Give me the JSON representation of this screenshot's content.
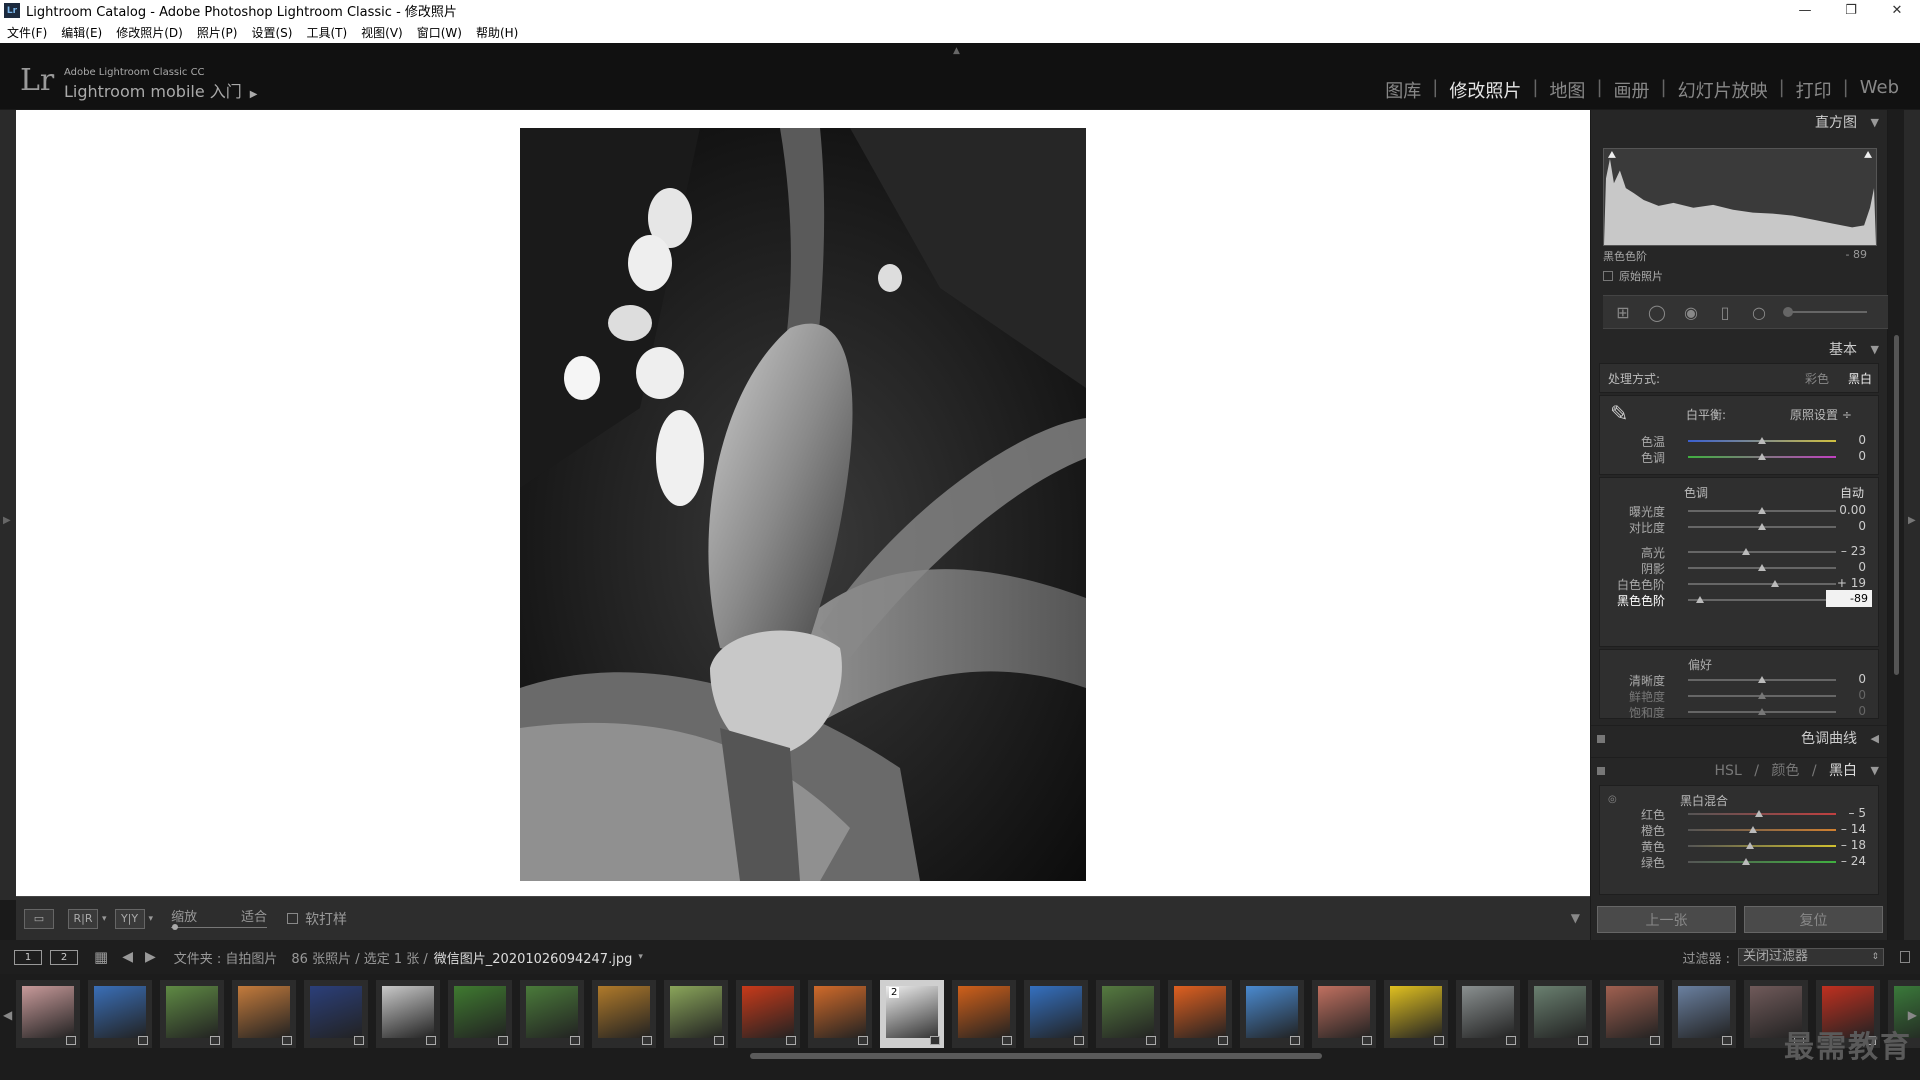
{
  "window": {
    "title": "Lightroom Catalog - Adobe Photoshop Lightroom Classic - 修改照片",
    "app_icon": "Lr"
  },
  "menu": [
    "文件(F)",
    "编辑(E)",
    "修改照片(D)",
    "照片(P)",
    "设置(S)",
    "工具(T)",
    "视图(V)",
    "窗口(W)",
    "帮助(H)"
  ],
  "identity": {
    "logo": "Lr",
    "product": "Adobe Lightroom Classic CC",
    "mobile": "Lightroom mobile 入门"
  },
  "modules": [
    "图库",
    "修改照片",
    "地图",
    "画册",
    "幻灯片放映",
    "打印",
    "Web"
  ],
  "active_module": "修改照片",
  "toolbar": {
    "zoom_label": "缩放",
    "fit_label": "适合",
    "softproof": "软打样"
  },
  "histogram": {
    "title": "直方图",
    "label": "黑色色阶",
    "value": "- 89",
    "original": "原始照片"
  },
  "basic": {
    "title": "基本",
    "treatment_label": "处理方式:",
    "treatment_color": "彩色",
    "treatment_bw": "黑白",
    "wb_label": "白平衡:",
    "wb_value": "原照设置 ÷",
    "tone_label": "色调",
    "auto": "自动",
    "presence_label": "偏好",
    "wb_sliders": [
      {
        "label": "色温",
        "value": "0",
        "pos": 0.5
      },
      {
        "label": "色调",
        "value": "0",
        "pos": 0.5
      }
    ],
    "tone_sliders": [
      {
        "label": "曝光度",
        "value": "0.00",
        "pos": 0.5
      },
      {
        "label": "对比度",
        "value": "0",
        "pos": 0.5
      }
    ],
    "tone_sliders2": [
      {
        "label": "高光",
        "value": "– 23",
        "pos": 0.39
      },
      {
        "label": "阴影",
        "value": "0",
        "pos": 0.5
      },
      {
        "label": "白色色阶",
        "value": "+ 19",
        "pos": 0.59
      },
      {
        "label": "黑色色阶",
        "value": "-89",
        "pos": 0.08
      }
    ],
    "presence_sliders": [
      {
        "label": "清晰度",
        "value": "0",
        "pos": 0.5
      },
      {
        "label": "鲜艳度",
        "value": "0",
        "pos": 0.5
      },
      {
        "label": "饱和度",
        "value": "0",
        "pos": 0.5
      }
    ]
  },
  "tone_curve": {
    "title": "色调曲线"
  },
  "hsl": {
    "hsl": "HSL",
    "color": "颜色",
    "bw": "黑白",
    "sep": "/"
  },
  "bw_mix": {
    "title": "黑白混合",
    "sliders": [
      {
        "label": "红色",
        "value": "– 5",
        "pos": 0.48
      },
      {
        "label": "橙色",
        "value": "– 14",
        "pos": 0.44
      },
      {
        "label": "黄色",
        "value": "– 18",
        "pos": 0.42
      },
      {
        "label": "绿色",
        "value": "– 24",
        "pos": 0.39
      }
    ]
  },
  "nav_buttons": {
    "prev": "上一张",
    "reset": "复位"
  },
  "filmbar": {
    "page1": "1",
    "page2": "2",
    "folder": "文件夹 : 自拍图片",
    "count": "86 张照片 / 选定 1 张 /",
    "filename": "微信图片_20201026094247.jpg",
    "filter_label": "过滤器 :",
    "filter_value": "关闭过滤器"
  },
  "filmstrip": {
    "selected_index": 12,
    "selected_number": "2",
    "thumbs": [
      "#c89a9a",
      "#3a6fb8",
      "#5f8a44",
      "#c47b3c",
      "#2b3f7a",
      "#c9c9c9",
      "#3f7a30",
      "#4a7a3a",
      "#b07a2a",
      "#8aa55a",
      "#c83a1a",
      "#d06a2a",
      "#555555",
      "#d0601a",
      "#3470c0",
      "#557a40",
      "#e06020",
      "#4a8ad0",
      "#c07060",
      "#e0c020",
      "#8a9090",
      "#6a8070",
      "#a06050",
      "#6a80a0",
      "#705a5a",
      "#c03020",
      "#3a7a3a"
    ]
  },
  "watermark": "最需教育"
}
